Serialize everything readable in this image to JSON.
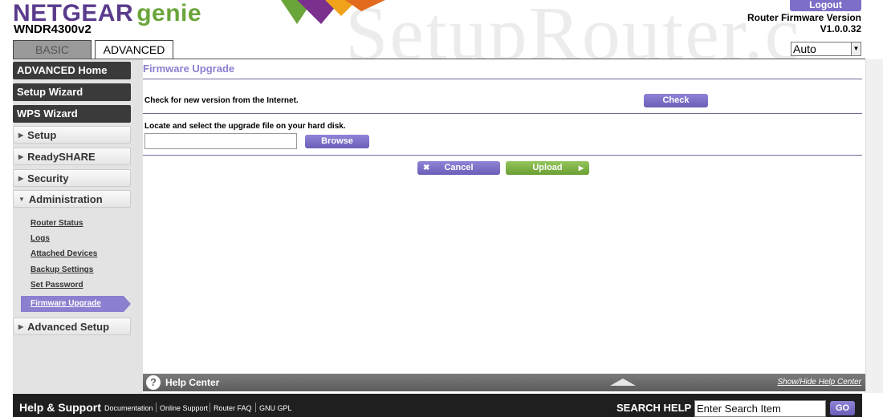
{
  "header": {
    "brand": "NETGEAR",
    "brand_sub": "genie",
    "model": "WNDR4300v2",
    "watermark": "SetupRouter.c",
    "logout_label": "Logout",
    "firmware_label": "Router Firmware Version",
    "firmware_version": "V1.0.0.32",
    "language_selected": "Auto"
  },
  "tabs": [
    {
      "label": "BASIC"
    },
    {
      "label": "ADVANCED"
    }
  ],
  "sidebar": {
    "primary": [
      {
        "label": "ADVANCED Home"
      },
      {
        "label": "Setup Wizard"
      },
      {
        "label": "WPS Wizard"
      }
    ],
    "sections": [
      {
        "label": "Setup"
      },
      {
        "label": "ReadySHARE"
      },
      {
        "label": "Security"
      },
      {
        "label": "Administration"
      },
      {
        "label": "Advanced Setup"
      }
    ],
    "admin_links": [
      {
        "label": "Router Status"
      },
      {
        "label": "Logs"
      },
      {
        "label": "Attached Devices"
      },
      {
        "label": "Backup Settings"
      },
      {
        "label": "Set Password"
      }
    ],
    "active_link": "Firmware Upgrade"
  },
  "main": {
    "title": "Firmware Upgrade",
    "check_text": "Check for new version from the Internet.",
    "check_button": "Check",
    "locate_text": "Locate and select the upgrade file on your hard disk.",
    "file_value": "",
    "browse_button": "Browse",
    "cancel_button": "Cancel",
    "upload_button": "Upload"
  },
  "help": {
    "title": "Help Center",
    "toggle": "Show/Hide Help Center"
  },
  "footer": {
    "title": "Help & Support",
    "links": [
      "Documentation",
      "Online Support",
      "Router FAQ",
      "GNU GPL"
    ],
    "search_label": "SEARCH HELP",
    "search_placeholder": "Enter Search Item",
    "go_button": "GO"
  },
  "colors": {
    "brand_purple": "#5a3b8c",
    "brand_green": "#6aa53a",
    "accent_purple": "#8b7fcf",
    "upload_green": "#7fb446"
  }
}
